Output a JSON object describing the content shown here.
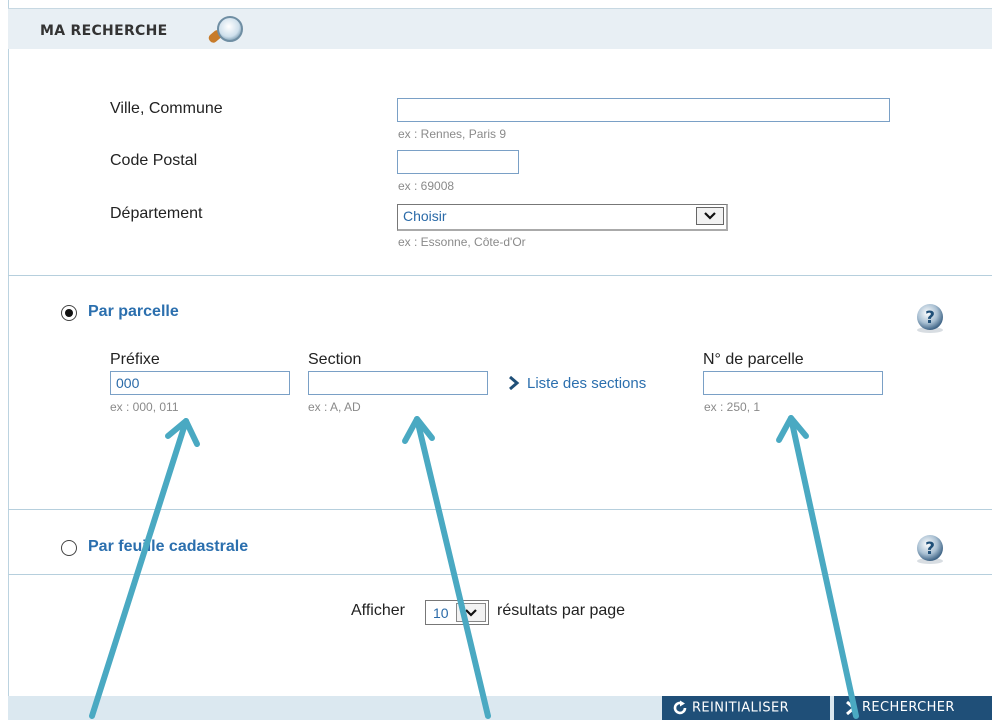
{
  "header": {
    "title": "MA RECHERCHE"
  },
  "location": {
    "city_label": "Ville, Commune",
    "city_value": "",
    "city_hint": "ex : Rennes, Paris 9",
    "postal_label": "Code Postal",
    "postal_value": "",
    "postal_hint": "ex : 69008",
    "dept_label": "Département",
    "dept_selected": "Choisir",
    "dept_hint": "ex : Essonne, Côte-d'Or"
  },
  "parcel_mode": {
    "label": "Par parcelle",
    "selected": true,
    "prefix_label": "Préfixe",
    "prefix_value": "000",
    "prefix_hint": "ex : 000, 011",
    "section_label": "Section",
    "section_value": "",
    "section_hint": "ex : A, AD",
    "sections_link": "Liste des sections",
    "parcel_label": "N° de parcelle",
    "parcel_value": "",
    "parcel_hint": "ex : 250, 1"
  },
  "sheet_mode": {
    "label": "Par feuille cadastrale",
    "selected": false
  },
  "results": {
    "prefix": "Afficher",
    "per_page_value": "10",
    "suffix": "résultats par page"
  },
  "actions": {
    "reset_label": "REINITIALISER",
    "search_label": "RECHERCHER"
  },
  "colors": {
    "accent": "#2b6fae",
    "header_bg": "#e8eff4",
    "button_bg": "#1f4f78",
    "annotation_arrow": "#4aa9c2"
  },
  "icons": [
    "magnifier-icon",
    "help-icon",
    "chevron-right-icon",
    "refresh-icon",
    "dropdown-arrow-icon"
  ]
}
